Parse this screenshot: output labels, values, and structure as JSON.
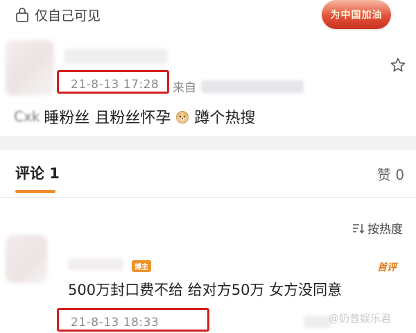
{
  "privacy": {
    "label": "仅自己可见",
    "icon": "lock-icon"
  },
  "badge": {
    "label": "为中国加油"
  },
  "post": {
    "time": "21-8-13 17:28",
    "from_label": "来自",
    "star_icon": "star-icon",
    "content_blurred": "Cxk",
    "content_part1": "睡粉丝 且粉丝怀孕",
    "emoji_icon": "dog-face-icon",
    "content_part2": "蹲个热搜"
  },
  "comments": {
    "title": "评论 1",
    "likes": "赞 0",
    "sort_label": "按热度"
  },
  "comment": {
    "badge": "博主",
    "first_label": "首评",
    "text": "500万封口费不给 给对方50万 女方没同意",
    "time": "21-8-13 18:33"
  },
  "watermark": "@奶昔娱乐君",
  "colors": {
    "highlight_box": "#d41e1e",
    "accent_orange": "#f08a2a",
    "muted_text": "#8a8a8a"
  }
}
